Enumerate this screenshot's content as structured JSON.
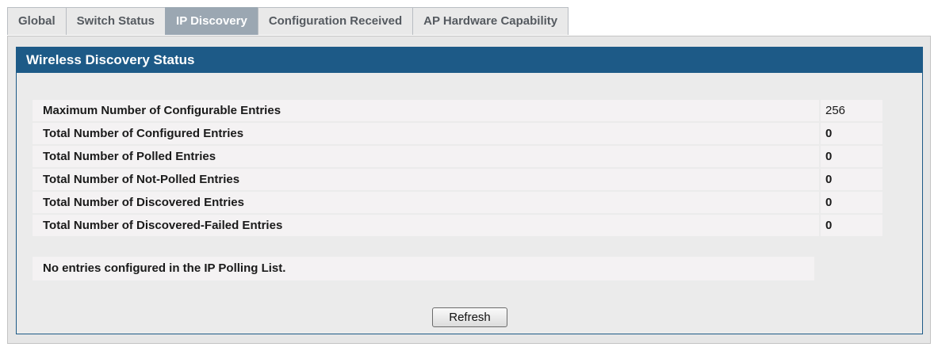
{
  "tabs": [
    {
      "label": "Global"
    },
    {
      "label": "Switch Status"
    },
    {
      "label": "IP Discovery",
      "active": true
    },
    {
      "label": "Configuration Received"
    },
    {
      "label": "AP Hardware Capability"
    }
  ],
  "panel": {
    "title": "Wireless Discovery Status",
    "rows": [
      {
        "label": "Maximum Number of Configurable Entries",
        "value": "256"
      },
      {
        "label": "Total Number of Configured Entries",
        "value": "0"
      },
      {
        "label": "Total Number of Polled Entries",
        "value": "0"
      },
      {
        "label": "Total Number of Not-Polled Entries",
        "value": "0"
      },
      {
        "label": "Total Number of Discovered Entries",
        "value": "0"
      },
      {
        "label": "Total Number of Discovered-Failed Entries",
        "value": "0"
      }
    ],
    "message": "No entries configured in the IP Polling List.",
    "refresh_label": "Refresh"
  },
  "colors": {
    "header_blue": "#1d5a87",
    "active_tab": "#9ba7b2",
    "row_bg": "#f4f2f3"
  }
}
